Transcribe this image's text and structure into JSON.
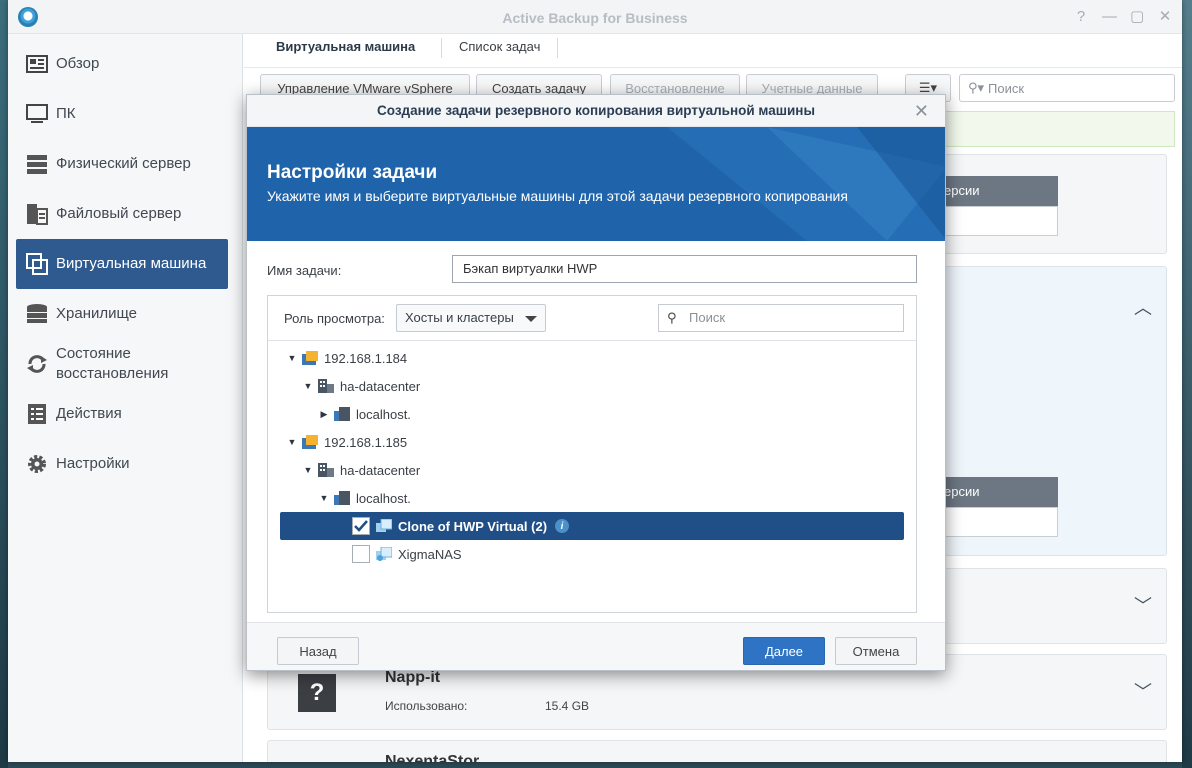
{
  "app": {
    "title": "Active Backup for Business"
  },
  "window_controls": [
    "?",
    "—",
    "▢",
    "✕"
  ],
  "sidebar": {
    "items": [
      {
        "label": "Обзор",
        "icon": "overview-icon"
      },
      {
        "label": "ПК",
        "icon": "monitor-icon"
      },
      {
        "label": "Физический сервер",
        "icon": "server-icon"
      },
      {
        "label": "Файловый сервер",
        "icon": "file-server-icon"
      },
      {
        "label": "Виртуальная машина",
        "icon": "virtual-machine-icon",
        "active": true
      },
      {
        "label": "Хранилище",
        "icon": "storage-icon"
      },
      {
        "label": "Состояние восстановления",
        "icon": "restore-status-icon"
      },
      {
        "label": "Действия",
        "icon": "log-icon"
      },
      {
        "label": "Настройки",
        "icon": "gear-icon"
      }
    ]
  },
  "main": {
    "tabs": [
      {
        "label": "Виртуальная машина"
      },
      {
        "label": "Список задач"
      }
    ],
    "toolbar": {
      "manage_vmware": "Управление VMware vSphere",
      "create_task": "Создать задачу",
      "restore": "Восстановление",
      "credentials": "Учетные данные",
      "search_placeholder": "Поиск"
    },
    "background": {
      "version_label_1": "ерсии",
      "version_label_2": "ерсии",
      "card_name": "Napp-it",
      "card_used_label": "Использовано:",
      "card_used_value": "15.4 GB",
      "card_partial_name": "NexentaStor"
    }
  },
  "dialog": {
    "title": "Создание задачи резервного копирования виртуальной машины",
    "heading": "Настройки задачи",
    "subheading": "Укажите имя и выберите виртуальные машины для этой задачи резервного копирования",
    "task_name_label": "Имя задачи:",
    "task_name_value": "Бэкап виртуалки HWP",
    "view_role_label": "Роль просмотра:",
    "view_role_value": "Хосты и кластеры",
    "search_placeholder": "Поиск",
    "tree": [
      {
        "label": "192.168.1.184",
        "level": 0,
        "toggle": "expanded",
        "type": "host"
      },
      {
        "label": "ha-datacenter",
        "level": 1,
        "toggle": "expanded",
        "type": "datacenter"
      },
      {
        "label": "localhost.",
        "level": 2,
        "toggle": "collapsed",
        "type": "esxi"
      },
      {
        "label": "192.168.1.185",
        "level": 0,
        "toggle": "expanded",
        "type": "host"
      },
      {
        "label": "ha-datacenter",
        "level": 1,
        "toggle": "expanded",
        "type": "datacenter"
      },
      {
        "label": "localhost.",
        "level": 2,
        "toggle": "expanded",
        "type": "esxi"
      },
      {
        "label": "Clone of HWP Virtual (2)",
        "level": 3,
        "type": "vm",
        "checked": true,
        "selected": true,
        "info": true
      },
      {
        "label": "XigmaNAS",
        "level": 3,
        "type": "vm",
        "checked": false
      }
    ],
    "buttons": {
      "back": "Назад",
      "next": "Далее",
      "cancel": "Отмена"
    }
  },
  "colors": {
    "accent": "#2f74c4",
    "sidebar_active": "#2f5a8f",
    "banner": "#1f64aa",
    "selection": "#1f4f86"
  }
}
